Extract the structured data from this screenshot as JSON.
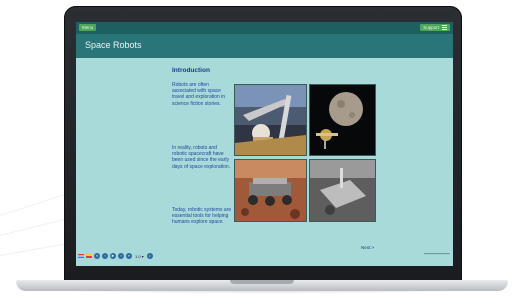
{
  "header": {
    "menu_label": "Menu",
    "support_label": "Support"
  },
  "page": {
    "title": "Space Robots",
    "section_heading": "Introduction",
    "paragraphs": [
      "Robots are often associated with space travel and exploration in science fiction stories.",
      "In reality, robots and robotic spacecraft have been used since the early days of space exploration.",
      "Today, robotic systems are essential tools for helping humans explore space."
    ],
    "next_label": "Next >"
  },
  "footer": {
    "speed_label": "1.0 ▾"
  },
  "icons": {
    "menu": "hamburger-icon",
    "playback": [
      "rewind-icon",
      "back-icon",
      "play-icon",
      "forward-icon",
      "fast-forward-icon"
    ],
    "audio": "speaker-icon"
  },
  "colors": {
    "content_bg": "#a8dad9",
    "topbar": "#1e5f62",
    "titlebar": "#2a7578",
    "accent_green": "#4fa75e",
    "text_blue": "#2744a0",
    "control_blue": "#2a6c9f"
  }
}
